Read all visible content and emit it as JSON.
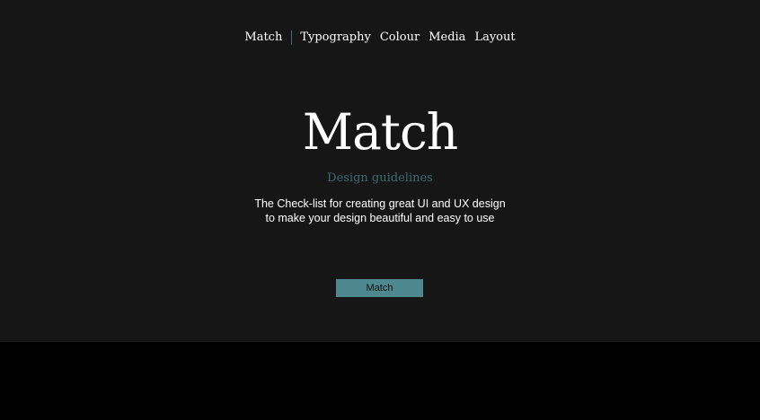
{
  "nav": {
    "brand": "Match",
    "links": [
      "Typography",
      "Colour",
      "Media",
      "Layout"
    ]
  },
  "hero": {
    "title": "Match",
    "subtitle": "Design guidelines",
    "description_line1": "The Check-list for creating great UI and UX design",
    "description_line2": "to make your design beautiful and easy to use",
    "cta_label": "Match"
  },
  "colors": {
    "background": "#161616",
    "footer": "#000000",
    "accent": "#4d888e",
    "subtitle": "#3d6a70",
    "text": "#ffffff"
  }
}
